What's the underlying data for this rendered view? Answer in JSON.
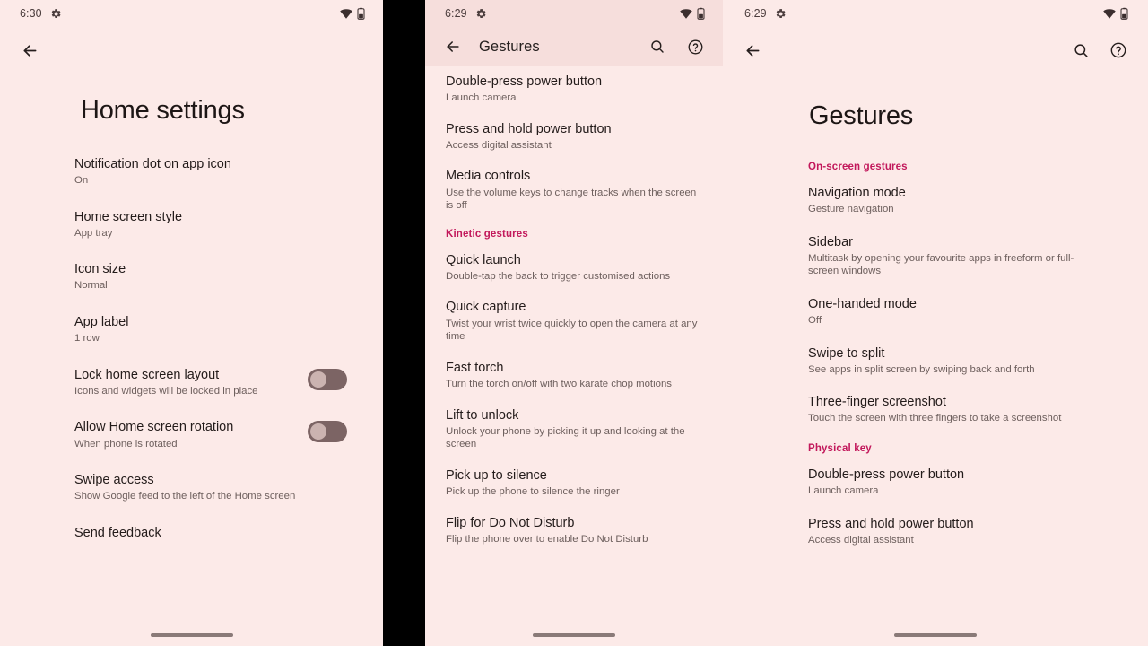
{
  "panels": [
    {
      "id": "home-settings",
      "statusbar": {
        "time": "6:30",
        "gear_icon": "gear-icon",
        "wifi_icon": "wifi-icon",
        "battery_icon": "battery-icon"
      },
      "appbar": {
        "back_icon": "back-arrow-icon",
        "title": ""
      },
      "title": "Home settings",
      "rows": [
        {
          "title": "Notification dot on app icon",
          "sub": "On",
          "toggle": null
        },
        {
          "title": "Home screen style",
          "sub": "App tray",
          "toggle": null
        },
        {
          "title": "Icon size",
          "sub": "Normal",
          "toggle": null
        },
        {
          "title": "App label",
          "sub": "1 row",
          "toggle": null
        },
        {
          "title": "Lock home screen layout",
          "sub": "Icons and widgets will be locked in place",
          "toggle": "off"
        },
        {
          "title": "Allow Home screen rotation",
          "sub": "When phone is rotated",
          "toggle": "off"
        },
        {
          "title": "Swipe access",
          "sub": "Show Google feed to the left of the Home screen",
          "toggle": null
        },
        {
          "title": "Send feedback",
          "sub": "",
          "toggle": null
        }
      ]
    },
    {
      "id": "gestures-scrolled",
      "statusbar": {
        "time": "6:29",
        "gear_icon": "gear-icon",
        "wifi_icon": "wifi-icon",
        "battery_icon": "battery-icon"
      },
      "appbar": {
        "back_icon": "back-arrow-icon",
        "title": "Gestures",
        "search_icon": "search-icon",
        "help_icon": "help-icon"
      },
      "title": "",
      "rows": [
        {
          "title": "Double-press power button",
          "sub": "Launch camera"
        },
        {
          "title": "Press and hold power button",
          "sub": "Access digital assistant"
        },
        {
          "title": "Media controls",
          "sub": "Use the volume keys to change tracks when the screen is off"
        },
        {
          "section": "Kinetic gestures"
        },
        {
          "title": "Quick launch",
          "sub": "Double-tap the back to trigger customised actions"
        },
        {
          "title": "Quick capture",
          "sub": "Twist your wrist twice quickly to open the camera at any time"
        },
        {
          "title": "Fast torch",
          "sub": "Turn the torch on/off with two karate chop motions"
        },
        {
          "title": "Lift to unlock",
          "sub": "Unlock your phone by picking it up and looking at the screen"
        },
        {
          "title": "Pick up to silence",
          "sub": "Pick up the phone to silence the ringer"
        },
        {
          "title": "Flip for Do Not Disturb",
          "sub": "Flip the phone over to enable Do Not Disturb"
        }
      ]
    },
    {
      "id": "gestures-top",
      "statusbar": {
        "time": "6:29",
        "gear_icon": "gear-icon",
        "wifi_icon": "wifi-icon",
        "battery_icon": "battery-icon"
      },
      "appbar": {
        "back_icon": "back-arrow-icon",
        "title": "",
        "search_icon": "search-icon",
        "help_icon": "help-icon"
      },
      "title": "Gestures",
      "rows": [
        {
          "section": "On-screen gestures"
        },
        {
          "title": "Navigation mode",
          "sub": "Gesture navigation"
        },
        {
          "title": "Sidebar",
          "sub": "Multitask by opening your favourite apps in freeform or full-screen windows"
        },
        {
          "title": "One-handed mode",
          "sub": "Off"
        },
        {
          "title": "Swipe to split",
          "sub": "See apps in split screen by swiping back and forth"
        },
        {
          "title": "Three-finger screenshot",
          "sub": "Touch the screen with three fingers to take a screenshot"
        },
        {
          "section": "Physical key"
        },
        {
          "title": "Double-press power button",
          "sub": "Launch camera"
        },
        {
          "title": "Press and hold power button",
          "sub": "Access digital assistant"
        }
      ]
    }
  ],
  "colors": {
    "background": "#FCEAE8",
    "scrim": "#F6DEDC",
    "accent": "#C2185B",
    "title_text": "#1d1615",
    "body_text": "#231b1a",
    "sub_text": "#6d5f5d",
    "toggle_track": "#7c6464",
    "toggle_thumb": "#cbb3b0",
    "home_indicator": "#8a7a78"
  }
}
